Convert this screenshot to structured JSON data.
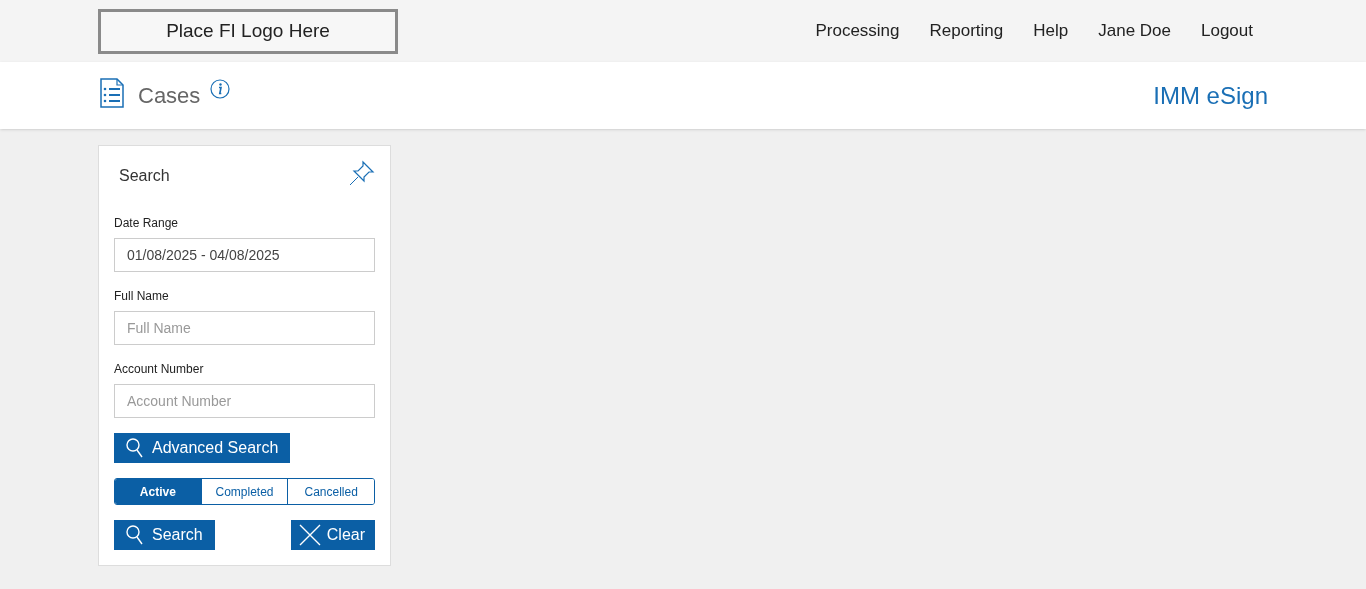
{
  "header": {
    "logo": "Place FI Logo Here",
    "nav": [
      "Processing",
      "Reporting",
      "Help",
      "Jane Doe",
      "Logout"
    ]
  },
  "title_bar": {
    "title": "Cases",
    "brand": "IMM eSign"
  },
  "search_panel": {
    "title": "Search",
    "fields": [
      {
        "label": "Date Range",
        "value": "01/08/2025 - 04/08/2025"
      },
      {
        "label": "Full Name",
        "placeholder": "Full Name"
      },
      {
        "label": "Account Number",
        "placeholder": "Account Number"
      }
    ],
    "advanced_button": "Advanced Search",
    "status_tabs": [
      {
        "label": "Active",
        "selected": true
      },
      {
        "label": "Completed",
        "selected": false
      },
      {
        "label": "Cancelled",
        "selected": false
      }
    ],
    "search_button": "Search",
    "clear_button": "Clear"
  }
}
